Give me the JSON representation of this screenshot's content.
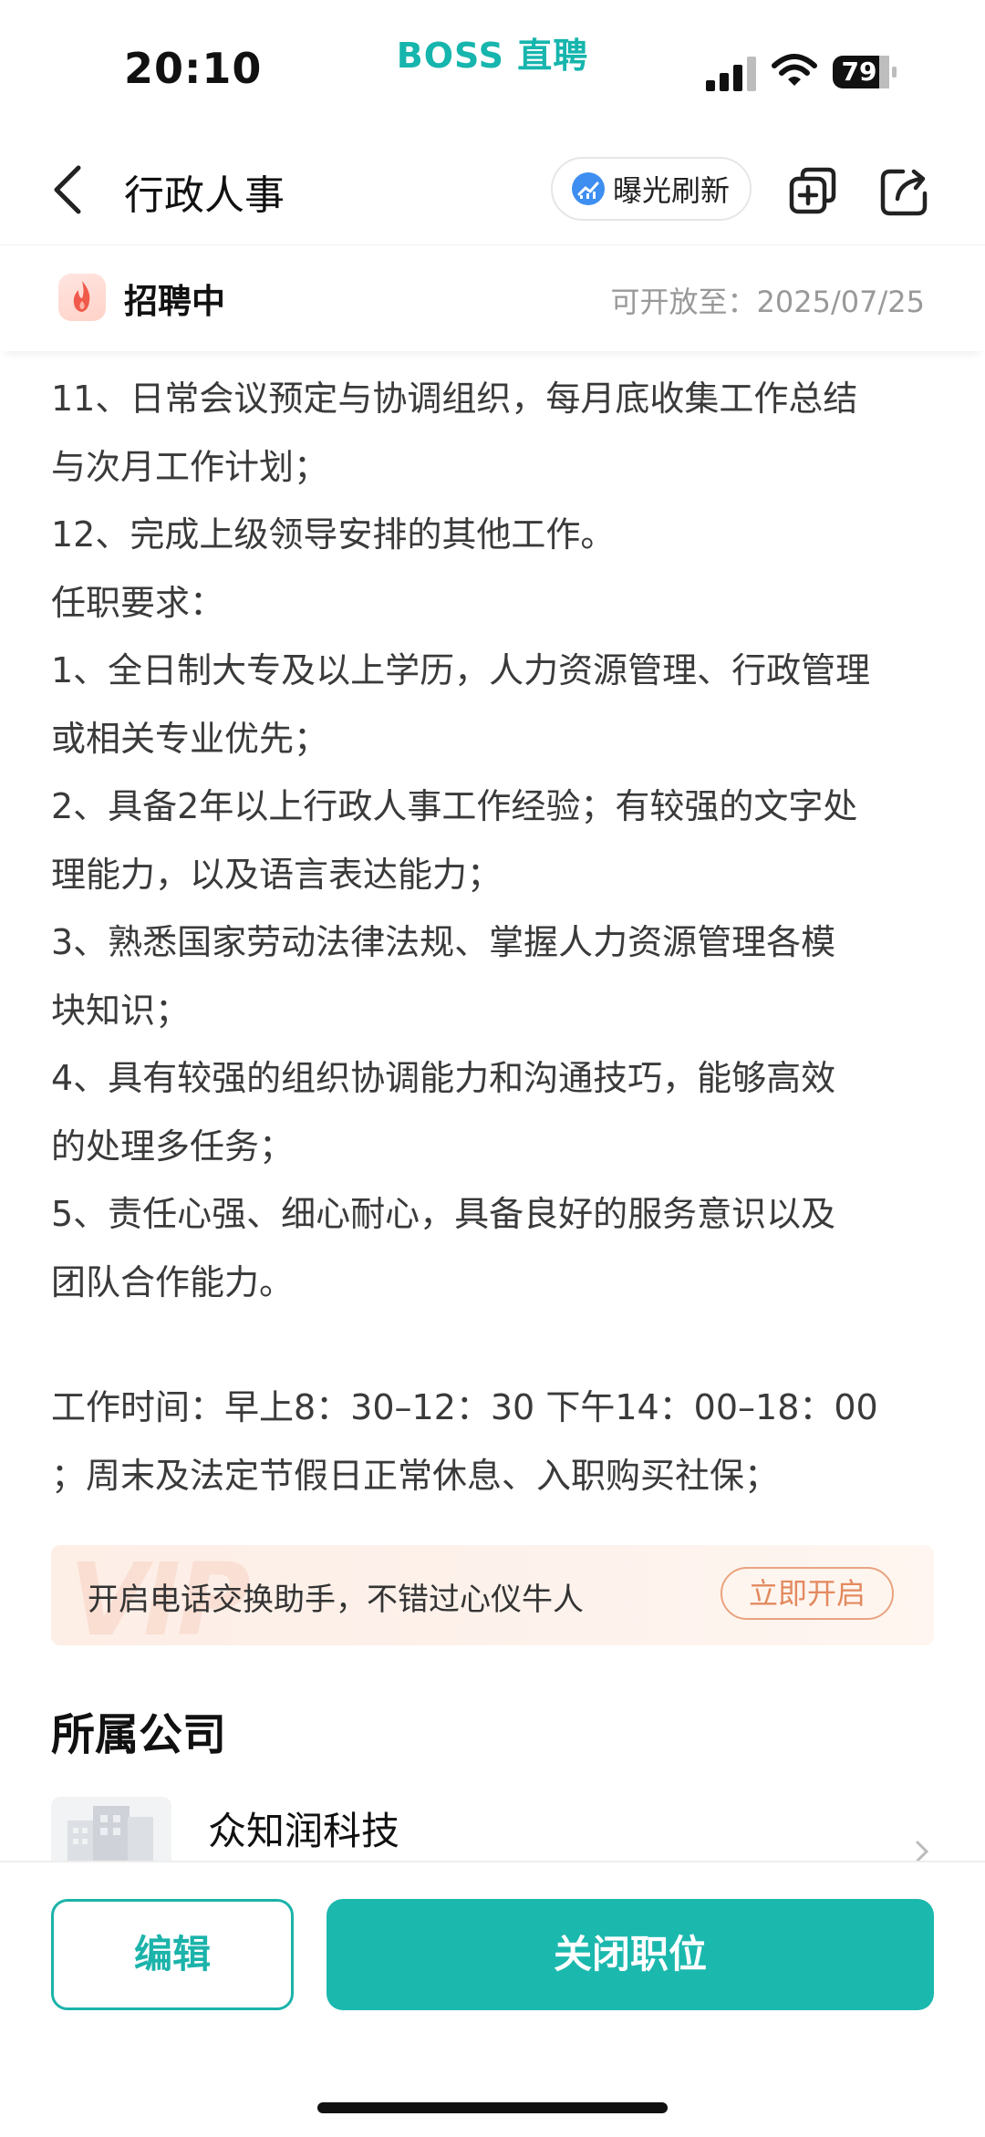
{
  "status_bar": {
    "time": "20:10",
    "brand": "BOSS 直聘",
    "battery": "79"
  },
  "nav": {
    "title": "行政人事",
    "exposure_label": "曝光刷新"
  },
  "job_status": {
    "label": "招聘中",
    "open_until": "可开放至：2025/07/25"
  },
  "description": {
    "lines": [
      "11、日常会议预定与协调组织，每月底收集工作总结",
      "与次月工作计划；",
      "12、完成上级领导安排的其他工作。",
      "任职要求：",
      "1、全日制大专及以上学历，人力资源管理、行政管理",
      "或相关专业优先；",
      "2、具备2年以上行政人事工作经验；有较强的文字处",
      "理能力，以及语言表达能力；",
      "3、熟悉国家劳动法律法规、掌握人力资源管理各模",
      "块知识；",
      "4、具有较强的组织协调能力和沟通技巧，能够高效",
      "的处理多任务；",
      "5、责任心强、细心耐心，具备良好的服务意识以及",
      "团队合作能力。"
    ],
    "work_time_lines": [
      "工作时间：早上8：30–12：30  下午14：00–18：00",
      "；周末及法定节假日正常休息、入职购买社保；"
    ]
  },
  "vip_banner": {
    "watermark": "VIP",
    "text": "开启电话交换助手，不错过心仪牛人",
    "button": "立即开启"
  },
  "company": {
    "section_title": "所属公司",
    "name": "众知润科技"
  },
  "actions": {
    "edit": "编辑",
    "close": "关闭职位"
  },
  "colors": {
    "brand": "#16b5ad",
    "primary_button": "#1bb8ae",
    "vip_accent": "#e38a5f"
  }
}
